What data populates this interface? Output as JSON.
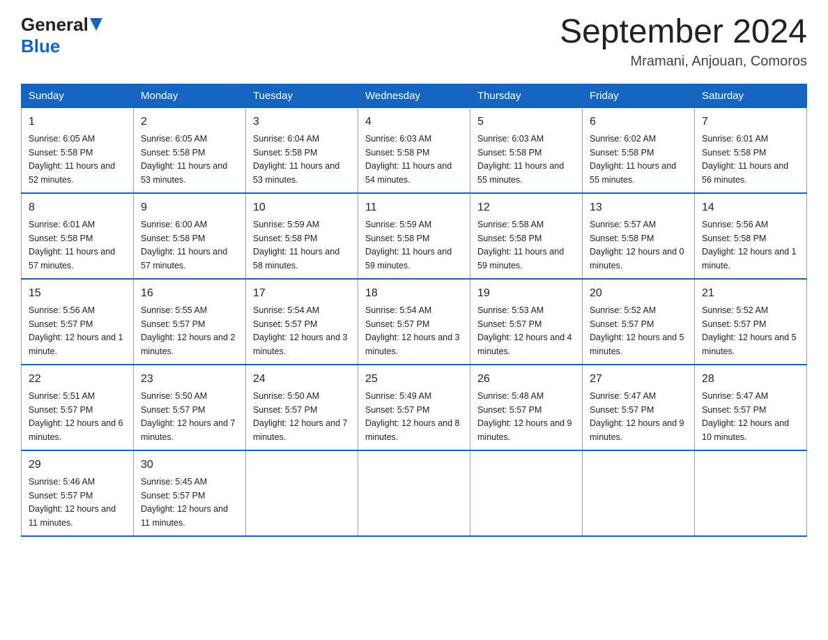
{
  "header": {
    "logo_general": "General",
    "logo_blue": "Blue",
    "month_year": "September 2024",
    "location": "Mramani, Anjouan, Comoros"
  },
  "weekdays": [
    "Sunday",
    "Monday",
    "Tuesday",
    "Wednesday",
    "Thursday",
    "Friday",
    "Saturday"
  ],
  "weeks": [
    [
      {
        "day": "1",
        "sunrise": "6:05 AM",
        "sunset": "5:58 PM",
        "daylight": "11 hours and 52 minutes."
      },
      {
        "day": "2",
        "sunrise": "6:05 AM",
        "sunset": "5:58 PM",
        "daylight": "11 hours and 53 minutes."
      },
      {
        "day": "3",
        "sunrise": "6:04 AM",
        "sunset": "5:58 PM",
        "daylight": "11 hours and 53 minutes."
      },
      {
        "day": "4",
        "sunrise": "6:03 AM",
        "sunset": "5:58 PM",
        "daylight": "11 hours and 54 minutes."
      },
      {
        "day": "5",
        "sunrise": "6:03 AM",
        "sunset": "5:58 PM",
        "daylight": "11 hours and 55 minutes."
      },
      {
        "day": "6",
        "sunrise": "6:02 AM",
        "sunset": "5:58 PM",
        "daylight": "11 hours and 55 minutes."
      },
      {
        "day": "7",
        "sunrise": "6:01 AM",
        "sunset": "5:58 PM",
        "daylight": "11 hours and 56 minutes."
      }
    ],
    [
      {
        "day": "8",
        "sunrise": "6:01 AM",
        "sunset": "5:58 PM",
        "daylight": "11 hours and 57 minutes."
      },
      {
        "day": "9",
        "sunrise": "6:00 AM",
        "sunset": "5:58 PM",
        "daylight": "11 hours and 57 minutes."
      },
      {
        "day": "10",
        "sunrise": "5:59 AM",
        "sunset": "5:58 PM",
        "daylight": "11 hours and 58 minutes."
      },
      {
        "day": "11",
        "sunrise": "5:59 AM",
        "sunset": "5:58 PM",
        "daylight": "11 hours and 59 minutes."
      },
      {
        "day": "12",
        "sunrise": "5:58 AM",
        "sunset": "5:58 PM",
        "daylight": "11 hours and 59 minutes."
      },
      {
        "day": "13",
        "sunrise": "5:57 AM",
        "sunset": "5:58 PM",
        "daylight": "12 hours and 0 minutes."
      },
      {
        "day": "14",
        "sunrise": "5:56 AM",
        "sunset": "5:58 PM",
        "daylight": "12 hours and 1 minute."
      }
    ],
    [
      {
        "day": "15",
        "sunrise": "5:56 AM",
        "sunset": "5:57 PM",
        "daylight": "12 hours and 1 minute."
      },
      {
        "day": "16",
        "sunrise": "5:55 AM",
        "sunset": "5:57 PM",
        "daylight": "12 hours and 2 minutes."
      },
      {
        "day": "17",
        "sunrise": "5:54 AM",
        "sunset": "5:57 PM",
        "daylight": "12 hours and 3 minutes."
      },
      {
        "day": "18",
        "sunrise": "5:54 AM",
        "sunset": "5:57 PM",
        "daylight": "12 hours and 3 minutes."
      },
      {
        "day": "19",
        "sunrise": "5:53 AM",
        "sunset": "5:57 PM",
        "daylight": "12 hours and 4 minutes."
      },
      {
        "day": "20",
        "sunrise": "5:52 AM",
        "sunset": "5:57 PM",
        "daylight": "12 hours and 5 minutes."
      },
      {
        "day": "21",
        "sunrise": "5:52 AM",
        "sunset": "5:57 PM",
        "daylight": "12 hours and 5 minutes."
      }
    ],
    [
      {
        "day": "22",
        "sunrise": "5:51 AM",
        "sunset": "5:57 PM",
        "daylight": "12 hours and 6 minutes."
      },
      {
        "day": "23",
        "sunrise": "5:50 AM",
        "sunset": "5:57 PM",
        "daylight": "12 hours and 7 minutes."
      },
      {
        "day": "24",
        "sunrise": "5:50 AM",
        "sunset": "5:57 PM",
        "daylight": "12 hours and 7 minutes."
      },
      {
        "day": "25",
        "sunrise": "5:49 AM",
        "sunset": "5:57 PM",
        "daylight": "12 hours and 8 minutes."
      },
      {
        "day": "26",
        "sunrise": "5:48 AM",
        "sunset": "5:57 PM",
        "daylight": "12 hours and 9 minutes."
      },
      {
        "day": "27",
        "sunrise": "5:47 AM",
        "sunset": "5:57 PM",
        "daylight": "12 hours and 9 minutes."
      },
      {
        "day": "28",
        "sunrise": "5:47 AM",
        "sunset": "5:57 PM",
        "daylight": "12 hours and 10 minutes."
      }
    ],
    [
      {
        "day": "29",
        "sunrise": "5:46 AM",
        "sunset": "5:57 PM",
        "daylight": "12 hours and 11 minutes."
      },
      {
        "day": "30",
        "sunrise": "5:45 AM",
        "sunset": "5:57 PM",
        "daylight": "12 hours and 11 minutes."
      },
      null,
      null,
      null,
      null,
      null
    ]
  ],
  "labels": {
    "sunrise": "Sunrise:",
    "sunset": "Sunset:",
    "daylight": "Daylight:"
  }
}
